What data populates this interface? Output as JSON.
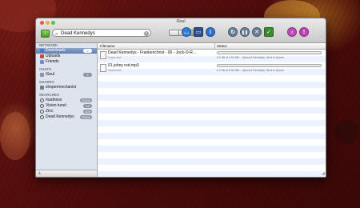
{
  "window": {
    "title": "iSoul"
  },
  "toolbar": {
    "search_value": "Dead Kennedys",
    "search_icon": "magnifier-icon",
    "view_modes": [
      "list",
      "columns",
      "cover"
    ],
    "buttons": [
      {
        "name": "speech-bubble",
        "color": "#2f7dd6",
        "glyph": "…"
      },
      {
        "name": "monitor",
        "color": "#2b4f8f",
        "glyph": "▭"
      },
      {
        "name": "info",
        "color": "#2f6fcf",
        "glyph": "i"
      },
      {
        "name": "resume",
        "color": "#6a7f9a",
        "glyph": "↻"
      },
      {
        "name": "pause",
        "color": "#6a7f9a",
        "glyph": "❚❚"
      },
      {
        "name": "stop",
        "color": "#6a7f9a",
        "glyph": "✕"
      },
      {
        "name": "clean",
        "color": "#3b8a2e",
        "glyph": "✓"
      },
      {
        "name": "music",
        "color": "#c04bb5",
        "glyph": "♪"
      },
      {
        "name": "alert",
        "color": "#c040b5",
        "glyph": "!"
      }
    ]
  },
  "sidebar": {
    "sections": [
      {
        "title": "NETWORK",
        "items": [
          {
            "label": "Downloads",
            "badge": "2",
            "selected": true,
            "icon_color": "#4a79c8"
          },
          {
            "label": "Uploads",
            "badge": "",
            "selected": false,
            "icon_color": "#d0453c"
          },
          {
            "label": "Friends",
            "badge": "",
            "selected": false,
            "icon_color": "#6b8fc9"
          }
        ]
      },
      {
        "title": "CHATS",
        "items": [
          {
            "label": "iSoul",
            "badge": "2",
            "selected": false,
            "icon_color": "#8a93a3"
          }
        ]
      },
      {
        "title": "SHARES",
        "items": [
          {
            "label": "shopermechanist",
            "badge": "",
            "selected": false,
            "icon_color": "#7d7d7d"
          }
        ]
      },
      {
        "title": "SEARCHES",
        "items": [
          {
            "label": "madness",
            "badge": "20600",
            "selected": false,
            "icon_color": "#7d7d7d"
          },
          {
            "label": "Vision tunel",
            "badge": "15",
            "selected": false,
            "icon_color": "#7d7d7d"
          },
          {
            "label": "Zinc",
            "badge": "225",
            "selected": false,
            "icon_color": "#7d7d7d"
          },
          {
            "label": "Dead Kennedys",
            "badge": "20600",
            "selected": false,
            "icon_color": "#7d7d7d"
          }
        ]
      }
    ],
    "add_label": "+"
  },
  "table": {
    "columns": [
      "Filename",
      "Status"
    ],
    "rows": [
      {
        "filename": "Dead Kennedys - Frankenchrist - 06 - Jock-O-R...",
        "user": "sugar.ultra",
        "progress": 0,
        "status": "0.0 kB of 4.52 MB – Queued Remotely, Next in Queue"
      },
      {
        "filename": "01 johny red.mp3",
        "user": "tatatadada",
        "progress": 0,
        "status": "0.0 kB of 5.95 MB – Queued Remotely, Next in Queue"
      }
    ]
  }
}
